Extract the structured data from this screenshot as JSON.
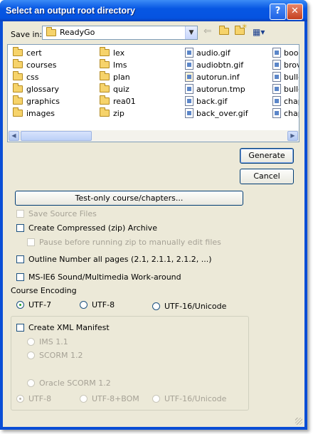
{
  "window": {
    "title": "Select an output root directory",
    "help_glyph": "?",
    "close_glyph": "✕"
  },
  "save_in": {
    "label": "Save in:",
    "value": "ReadyGo"
  },
  "toolbar": {
    "back_glyph": "⇐",
    "up_glyph": "⬆",
    "new_folder_glyph": "✳",
    "view_glyph": "▦▾"
  },
  "files": {
    "col1": [
      {
        "name": "cert",
        "icon": "folder-icon"
      },
      {
        "name": "courses",
        "icon": "folder-icon"
      },
      {
        "name": "css",
        "icon": "folder-icon"
      },
      {
        "name": "glossary",
        "icon": "folder-icon"
      },
      {
        "name": "graphics",
        "icon": "folder-icon"
      },
      {
        "name": "images",
        "icon": "folder-icon"
      }
    ],
    "col2": [
      {
        "name": "lex",
        "icon": "folder-icon"
      },
      {
        "name": "lms",
        "icon": "folder-icon"
      },
      {
        "name": "plan",
        "icon": "folder-icon"
      },
      {
        "name": "quiz",
        "icon": "folder-icon"
      },
      {
        "name": "rea01",
        "icon": "folder-icon"
      },
      {
        "name": "zip",
        "icon": "folder-icon"
      }
    ],
    "col3": [
      {
        "name": "audio.gif",
        "icon": "image-file-icon"
      },
      {
        "name": "audiobtn.gif",
        "icon": "image-file-icon"
      },
      {
        "name": "autorun.inf",
        "icon": "settings-file-icon"
      },
      {
        "name": "autorun.tmp",
        "icon": "image-file-icon"
      },
      {
        "name": "back.gif",
        "icon": "image-file-icon"
      },
      {
        "name": "back_over.gif",
        "icon": "image-file-icon"
      }
    ],
    "col4": [
      {
        "name": "book",
        "icon": "image-file-icon"
      },
      {
        "name": "brov",
        "icon": "window-file-icon"
      },
      {
        "name": "bulle",
        "icon": "image-file-icon"
      },
      {
        "name": "bulle",
        "icon": "image-file-icon"
      },
      {
        "name": "chap",
        "icon": "image-file-icon"
      },
      {
        "name": "chap",
        "icon": "image-file-icon"
      }
    ]
  },
  "buttons": {
    "generate": "Generate",
    "cancel": "Cancel",
    "test_only": "Test-only course/chapters..."
  },
  "options": {
    "save_source": "Save Source Files",
    "create_zip": "Create Compressed (zip) Archive",
    "pause_zip": "Pause before running zip to manually edit files",
    "outline_number": "Outline Number all pages (2.1, 2.1.1, 2.1.2, ...)",
    "ie6_workaround": "MS-IE6 Sound/Multimedia Work-around"
  },
  "encoding": {
    "label": "Course Encoding",
    "utf7": "UTF-7",
    "utf8": "UTF-8",
    "utf16": "UTF-16/Unicode",
    "selected": "UTF-7"
  },
  "xml": {
    "create_manifest": "Create XML Manifest",
    "ims": "IMS 1.1",
    "scorm12": "SCORM 1.2",
    "oracle": "Oracle SCORM 1.2",
    "enc_utf8": "UTF-8",
    "enc_utf8bom": "UTF-8+BOM",
    "enc_utf16": "UTF-16/Unicode",
    "selected_encoding": "UTF-8"
  }
}
